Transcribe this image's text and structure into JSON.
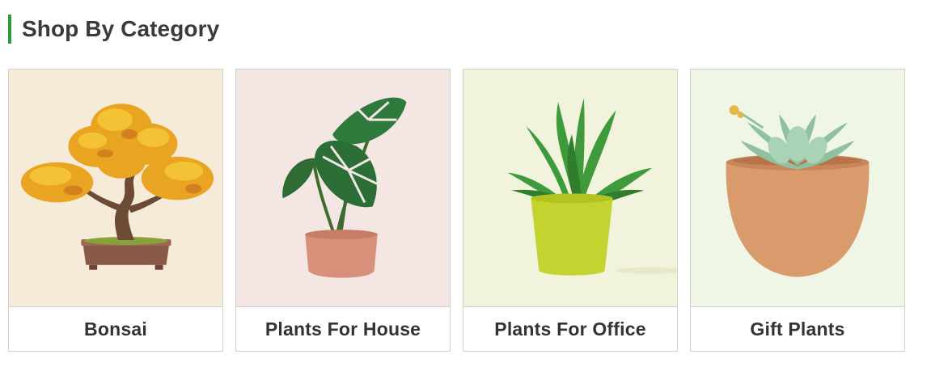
{
  "section": {
    "title": "Shop By Category",
    "accent_color": "#2e9a3a"
  },
  "categories": [
    {
      "label": "Bonsai",
      "image_icon": "bonsai-tree-icon",
      "background": "#f6ead8"
    },
    {
      "label": "Plants For House",
      "image_icon": "monstera-plant-icon",
      "background": "#f4e7e3"
    },
    {
      "label": "Plants For Office",
      "image_icon": "office-plant-icon",
      "background": "#f2f3dc"
    },
    {
      "label": "Gift Plants",
      "image_icon": "succulent-pot-icon",
      "background": "#eff6e5"
    }
  ]
}
